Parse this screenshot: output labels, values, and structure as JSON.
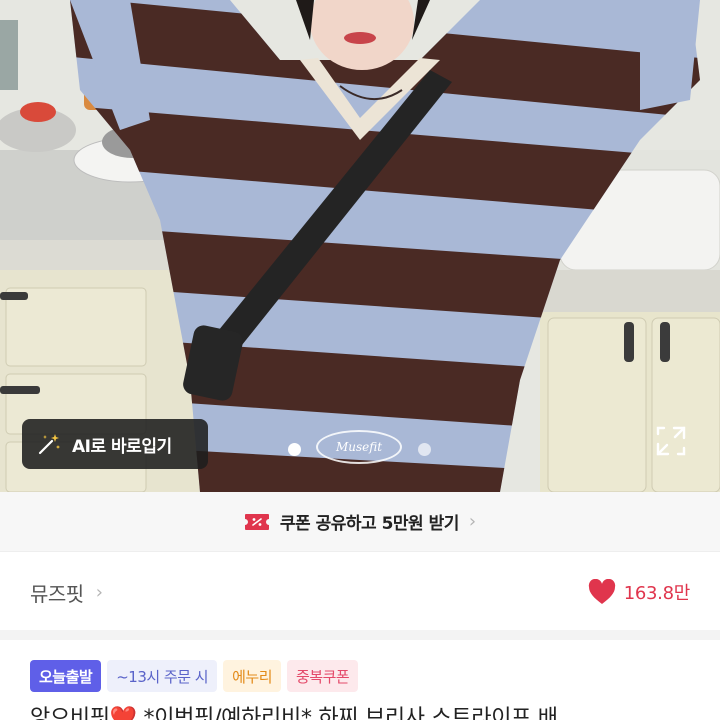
{
  "photo": {
    "ai_button_label": "AI로 바로입기",
    "brand_badge": "Musefit",
    "carousel_count": 2,
    "carousel_active": 1,
    "icons": {
      "ai": "magic-wand-icon",
      "expand": "expand-icon"
    }
  },
  "coupon": {
    "text": "쿠폰 공유하고 5만원 받기",
    "icon": "coupon-ticket-icon",
    "accent": "#e0354d"
  },
  "shop": {
    "name": "뮤즈핏",
    "likes": "163.8만",
    "like_color": "#e0354d"
  },
  "tags": [
    {
      "label": "오늘출발"
    },
    {
      "label": "~13시 주문 시"
    },
    {
      "label": "에누리"
    },
    {
      "label": "중복쿠폰"
    }
  ],
  "product": {
    "title_partial": "앙으비핏❤️ *이번핏/예하리비* 하찌 브리사 스트라이프 배"
  }
}
